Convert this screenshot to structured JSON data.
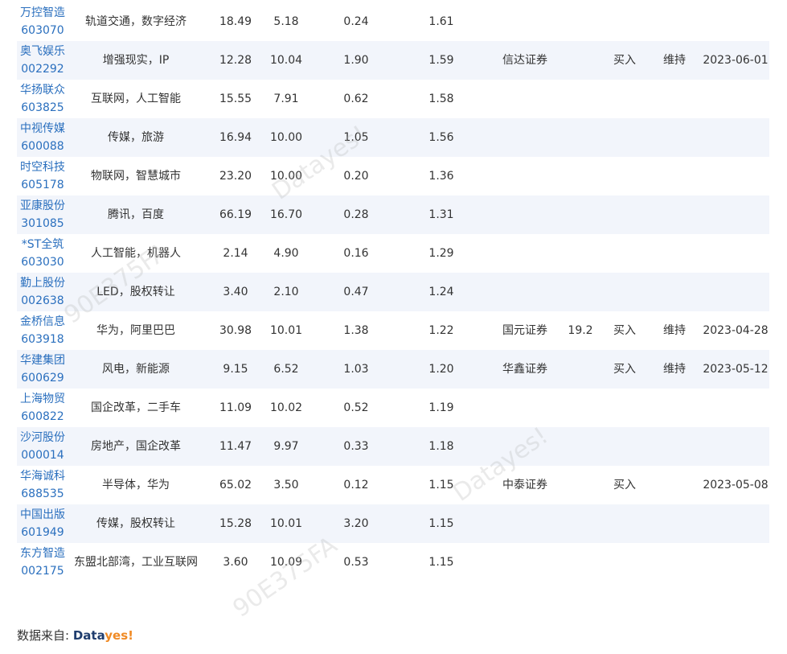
{
  "watermarks": [
    "Datayes!",
    "90E375FA",
    "Datayes!",
    "90E375FA"
  ],
  "rows": [
    {
      "name": "万控智造",
      "code": "603070",
      "concept": "轨道交通，数字经济",
      "price": "18.49",
      "chg": "5.18",
      "turnover": "0.24",
      "ratio": "1.61",
      "broker": "",
      "target": "",
      "rating": "",
      "change": "",
      "date": ""
    },
    {
      "name": "奥飞娱乐",
      "code": "002292",
      "concept": "增强现实，IP",
      "price": "12.28",
      "chg": "10.04",
      "turnover": "1.90",
      "ratio": "1.59",
      "broker": "信达证券",
      "target": "",
      "rating": "买入",
      "change": "维持",
      "date": "2023-06-01"
    },
    {
      "name": "华扬联众",
      "code": "603825",
      "concept": "互联网，人工智能",
      "price": "15.55",
      "chg": "7.91",
      "turnover": "0.62",
      "ratio": "1.58",
      "broker": "",
      "target": "",
      "rating": "",
      "change": "",
      "date": ""
    },
    {
      "name": "中视传媒",
      "code": "600088",
      "concept": "传媒，旅游",
      "price": "16.94",
      "chg": "10.00",
      "turnover": "1.05",
      "ratio": "1.56",
      "broker": "",
      "target": "",
      "rating": "",
      "change": "",
      "date": ""
    },
    {
      "name": "时空科技",
      "code": "605178",
      "concept": "物联网，智慧城市",
      "price": "23.20",
      "chg": "10.00",
      "turnover": "0.20",
      "ratio": "1.36",
      "broker": "",
      "target": "",
      "rating": "",
      "change": "",
      "date": ""
    },
    {
      "name": "亚康股份",
      "code": "301085",
      "concept": "腾讯，百度",
      "price": "66.19",
      "chg": "16.70",
      "turnover": "0.28",
      "ratio": "1.31",
      "broker": "",
      "target": "",
      "rating": "",
      "change": "",
      "date": ""
    },
    {
      "name": "*ST全筑",
      "code": "603030",
      "concept": "人工智能，机器人",
      "price": "2.14",
      "chg": "4.90",
      "turnover": "0.16",
      "ratio": "1.29",
      "broker": "",
      "target": "",
      "rating": "",
      "change": "",
      "date": ""
    },
    {
      "name": "勤上股份",
      "code": "002638",
      "concept": "LED，股权转让",
      "price": "3.40",
      "chg": "2.10",
      "turnover": "0.47",
      "ratio": "1.24",
      "broker": "",
      "target": "",
      "rating": "",
      "change": "",
      "date": ""
    },
    {
      "name": "金桥信息",
      "code": "603918",
      "concept": "华为，阿里巴巴",
      "price": "30.98",
      "chg": "10.01",
      "turnover": "1.38",
      "ratio": "1.22",
      "broker": "国元证券",
      "target": "19.2",
      "rating": "买入",
      "change": "维持",
      "date": "2023-04-28"
    },
    {
      "name": "华建集团",
      "code": "600629",
      "concept": "风电，新能源",
      "price": "9.15",
      "chg": "6.52",
      "turnover": "1.03",
      "ratio": "1.20",
      "broker": "华鑫证券",
      "target": "",
      "rating": "买入",
      "change": "维持",
      "date": "2023-05-12"
    },
    {
      "name": "上海物贸",
      "code": "600822",
      "concept": "国企改革，二手车",
      "price": "11.09",
      "chg": "10.02",
      "turnover": "0.52",
      "ratio": "1.19",
      "broker": "",
      "target": "",
      "rating": "",
      "change": "",
      "date": ""
    },
    {
      "name": "沙河股份",
      "code": "000014",
      "concept": "房地产，国企改革",
      "price": "11.47",
      "chg": "9.97",
      "turnover": "0.33",
      "ratio": "1.18",
      "broker": "",
      "target": "",
      "rating": "",
      "change": "",
      "date": ""
    },
    {
      "name": "华海诚科",
      "code": "688535",
      "concept": "半导体，华为",
      "price": "65.02",
      "chg": "3.50",
      "turnover": "0.12",
      "ratio": "1.15",
      "broker": "中泰证券",
      "target": "",
      "rating": "买入",
      "change": "",
      "date": "2023-05-08"
    },
    {
      "name": "中国出版",
      "code": "601949",
      "concept": "传媒，股权转让",
      "price": "15.28",
      "chg": "10.01",
      "turnover": "3.20",
      "ratio": "1.15",
      "broker": "",
      "target": "",
      "rating": "",
      "change": "",
      "date": ""
    },
    {
      "name": "东方智造",
      "code": "002175",
      "concept": "东盟北部湾，工业互联网",
      "price": "3.60",
      "chg": "10.09",
      "turnover": "0.53",
      "ratio": "1.15",
      "broker": "",
      "target": "",
      "rating": "",
      "change": "",
      "date": ""
    }
  ],
  "footer": {
    "label": "数据来自:",
    "logo_main": "Data",
    "logo_accent": "yes!"
  }
}
